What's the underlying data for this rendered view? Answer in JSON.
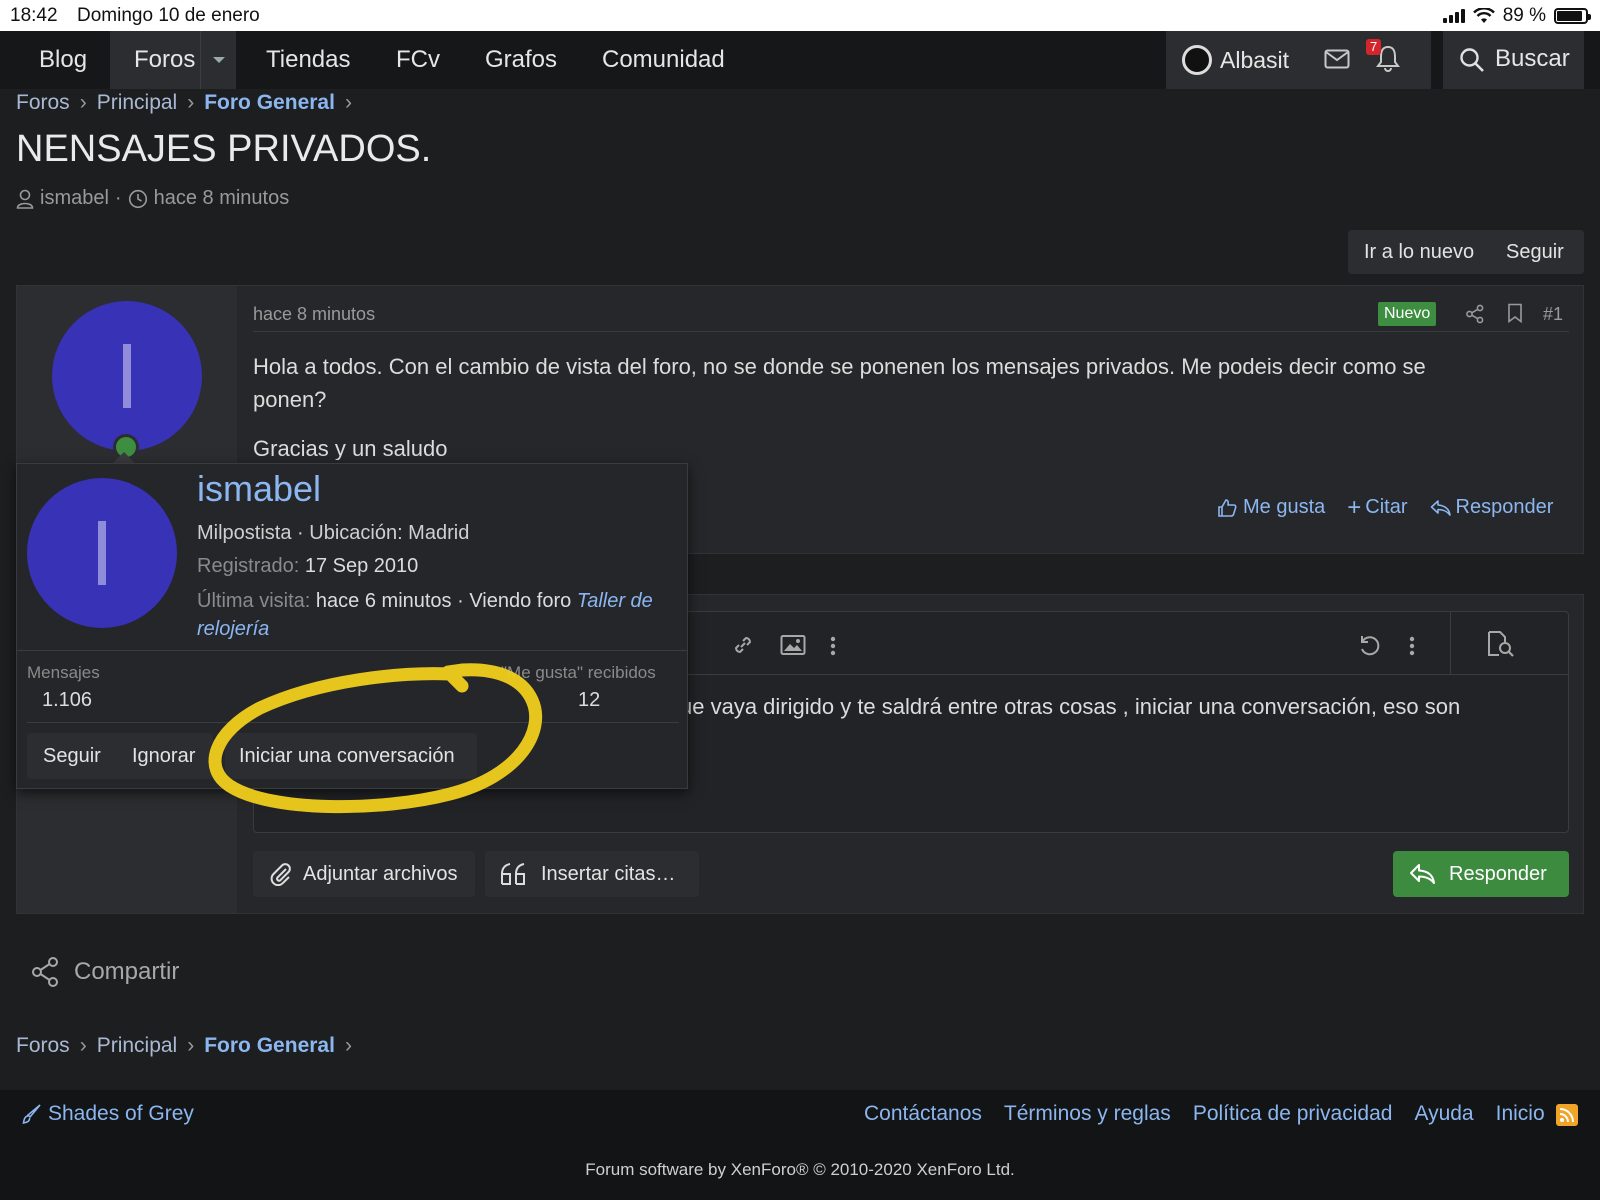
{
  "status_bar": {
    "time": "18:42",
    "date": "Domingo 10 de enero",
    "battery": "89 %",
    "battery_level": 0.89
  },
  "nav": {
    "items": [
      {
        "label": "Blog",
        "active": false
      },
      {
        "label": "Foros",
        "active": true
      },
      {
        "label": "Tiendas",
        "active": false
      },
      {
        "label": "FCv",
        "active": false
      },
      {
        "label": "Grafos",
        "active": false
      },
      {
        "label": "Comunidad",
        "active": false
      }
    ],
    "user": "Albasit",
    "alert_count": "7",
    "search_label": "Buscar"
  },
  "breadcrumb": {
    "items": [
      "Foros",
      "Principal"
    ],
    "current": "Foro General"
  },
  "thread": {
    "title": "NENSAJES PRIVADOS.",
    "author": "ismabel",
    "time": "hace 8 minutos"
  },
  "thread_buttons": {
    "new": "Ir a lo nuevo",
    "follow": "Seguir"
  },
  "post": {
    "time": "hace 8 minutos",
    "badge": "Nuevo",
    "number": "#1",
    "avatar_letter": "I",
    "body_line1": "Hola a todos. Con el cambio de vista del foro, no se donde se ponenen los mensajes privados. Me podeis decir como se",
    "body_line2": "ponen?",
    "body_line3": "Gracias y un saludo",
    "actions": {
      "like": "Me gusta",
      "quote": "Citar",
      "reply": "Responder"
    }
  },
  "popup": {
    "name": "ismabel",
    "avatar_letter": "I",
    "title_line": "Milpostista · Ubicación: Madrid",
    "registered_label": "Registrado:",
    "registered_value": "17 Sep 2010",
    "last_visit_label": "Última visita:",
    "last_visit_value": "hace 6 minutos · Viendo foro",
    "last_visit_link": "Taller de relojería",
    "stats": {
      "messages_label": "Mensajes",
      "messages_value": "1.106",
      "likes_label": "\"Me gusta\" recibidos",
      "likes_value": "12"
    },
    "buttons": {
      "follow": "Seguir",
      "ignore": "Ignorar",
      "conversation": "Iniciar una conversación"
    }
  },
  "editor": {
    "text": "ue vaya dirigido y te saldrá entre otras cosas , iniciar una conversación, eso son",
    "attach_label": "Adjuntar archivos",
    "insert_quotes_label": "Insertar citas…",
    "reply_label": "Responder"
  },
  "share": {
    "label": "Compartir"
  },
  "footer": {
    "style_label": "Shades of Grey",
    "links": [
      "Contáctanos",
      "Términos y reglas",
      "Política de privacidad",
      "Ayuda",
      "Inicio"
    ],
    "copyright": "Forum software by XenForo® © 2010-2020 XenForo Ltd."
  },
  "colors": {
    "accent": "#8bb6f0",
    "new_badge": "#3e8e41",
    "reply_button": "#3d8b3f",
    "avatar": "#3732b6",
    "highlight": "#f0cf1c",
    "alert": "#d3252b",
    "rss": "#f0a428"
  }
}
